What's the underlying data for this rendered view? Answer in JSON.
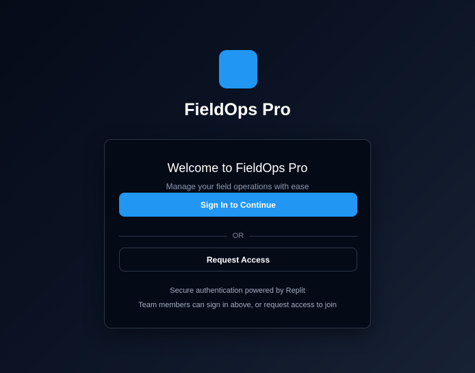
{
  "app": {
    "title": "FieldOps Pro",
    "logo_color": "#2196f3"
  },
  "login_card": {
    "title": "Welcome to FieldOps Pro",
    "subtitle": "Manage your field operations with ease",
    "primary_button_label": "Sign In to Continue",
    "divider_label": "OR",
    "secondary_button_label": "Request Access",
    "footnote_auth": "Secure authentication powered by Replit",
    "footnote_team": "Team members can sign in above, or request access to join"
  },
  "colors": {
    "accent": "#2196f3",
    "card_background": "#050a17",
    "page_background": "#0b1324"
  }
}
